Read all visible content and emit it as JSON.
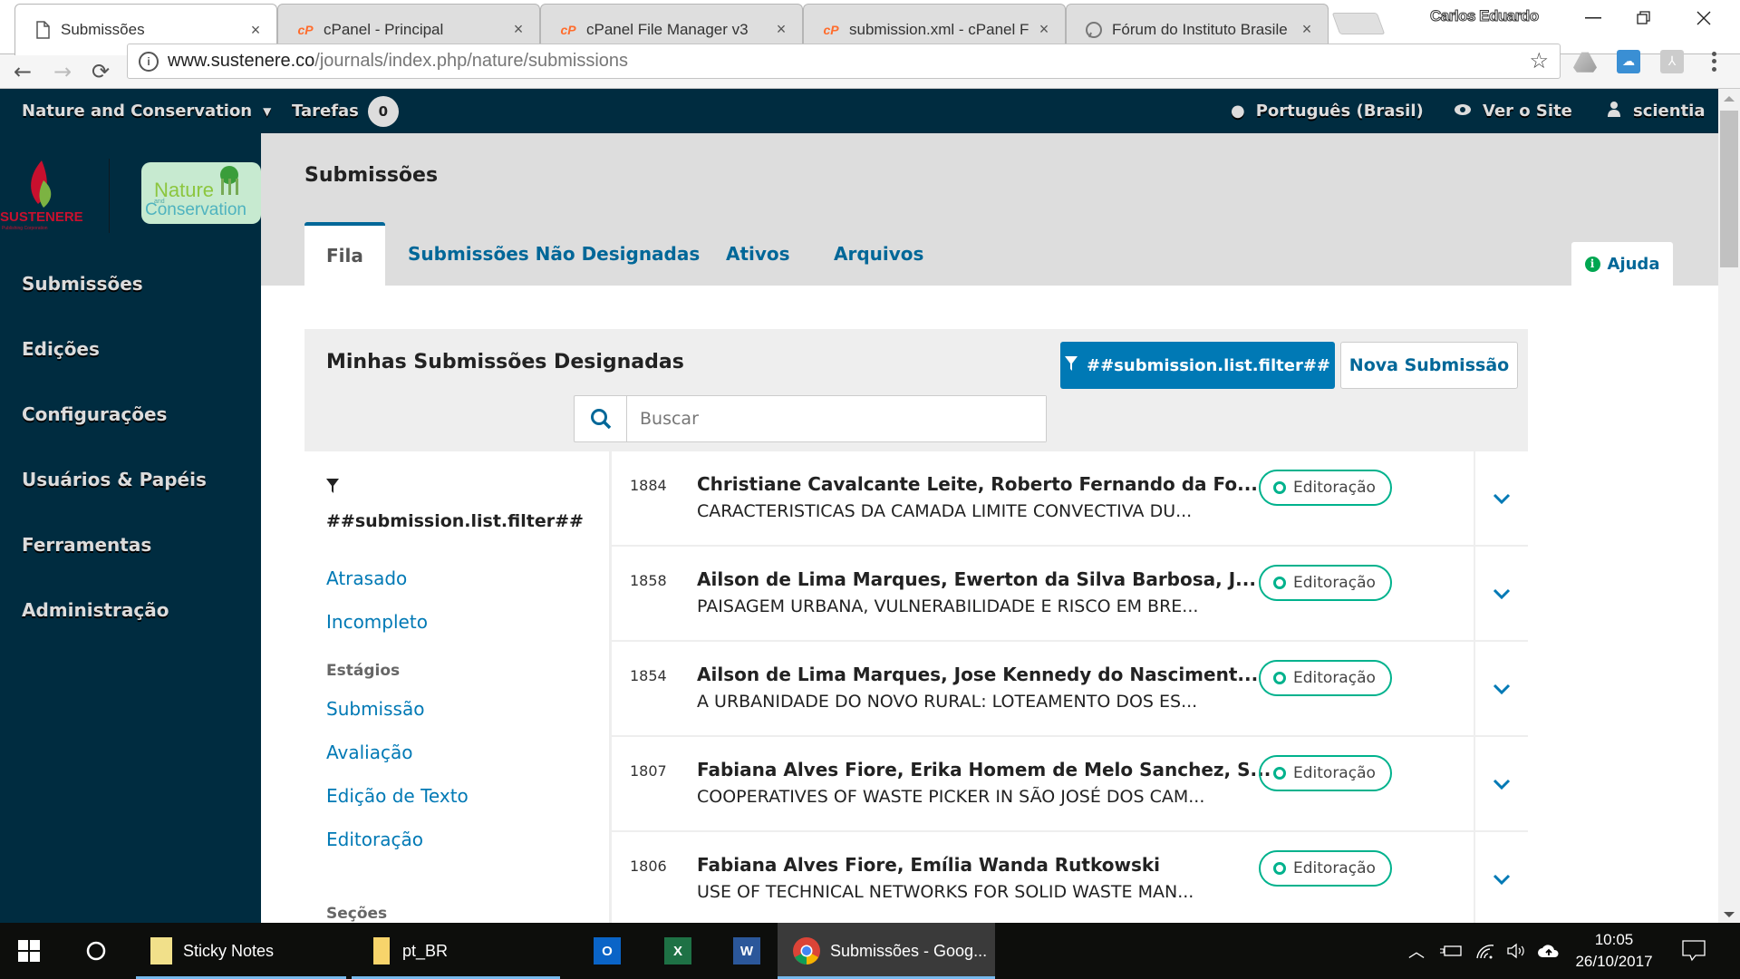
{
  "browser": {
    "tabs": [
      {
        "title": "Submissões",
        "icon": "page-icon",
        "active": true
      },
      {
        "title": "cPanel - Principal",
        "icon": "cpanel-icon",
        "active": false
      },
      {
        "title": "cPanel File Manager v3",
        "icon": "cpanel-icon",
        "active": false
      },
      {
        "title": "submission.xml - cPanel F",
        "icon": "cpanel-icon",
        "active": false
      },
      {
        "title": "Fórum do Instituto Brasile",
        "icon": "forum-icon",
        "active": false
      }
    ],
    "tab_close": "×",
    "profile_name": "Carlos Eduardo",
    "url_host": "www.sustenere.co",
    "url_path": "/journals/index.php/nature/submissions"
  },
  "header": {
    "journal_name": "Nature and Conservation",
    "tasks_label": "Tarefas",
    "tasks_count": "0",
    "language": "Português (Brasil)",
    "view_site": "Ver o Site",
    "user": "scientia"
  },
  "logos": {
    "publisher": "SUSTENERE",
    "publisher_sub": "Publishing Corporation",
    "journal_line1": "Nature",
    "journal_line2": "and",
    "journal_line3": "Conservation"
  },
  "sidebar": {
    "items": [
      {
        "label": "Submissões"
      },
      {
        "label": "Edições"
      },
      {
        "label": "Configurações"
      },
      {
        "label": "Usuários & Papéis"
      },
      {
        "label": "Ferramentas"
      },
      {
        "label": "Administração"
      }
    ]
  },
  "page": {
    "title": "Submissões",
    "tabs": [
      {
        "label": "Fila",
        "active": true
      },
      {
        "label": "Submissões Não Designadas"
      },
      {
        "label": "Ativos"
      },
      {
        "label": "Arquivos"
      }
    ],
    "help_label": "Ajuda"
  },
  "list": {
    "title": "Minhas Submissões Designadas",
    "filter_button": "##submission.list.filter##",
    "new_button": "Nova Submissão",
    "search_placeholder": "Buscar",
    "filters": {
      "heading": "##submission.list.filter##",
      "quick": [
        "Atrasado",
        "Incompleto"
      ],
      "stages_heading": "Estágios",
      "stages": [
        "Submissão",
        "Avaliação",
        "Edição de Texto",
        "Editoração"
      ],
      "sections_heading": "Seções"
    },
    "rows": [
      {
        "id": "1884",
        "authors": "Christiane Cavalcante Leite, Roberto Fernando da Fo...",
        "title": "CARACTERISTICAS DA CAMADA LIMITE CONVECTIVA DU...",
        "stage": "Editoração"
      },
      {
        "id": "1858",
        "authors": "Ailson de Lima Marques, Ewerton da Silva Barbosa, J...",
        "title": "PAISAGEM URBANA, VULNERABILIDADE E RISCO EM BRE...",
        "stage": "Editoração"
      },
      {
        "id": "1854",
        "authors": "Ailson de Lima Marques, Jose Kennedy do Nasciment...",
        "title": "A URBANIDADE DO NOVO RURAL: LOTEAMENTO DOS ES...",
        "stage": "Editoração"
      },
      {
        "id": "1807",
        "authors": "Fabiana Alves Fiore, Erika Homem de Melo Sanchez, S...",
        "title": "COOPERATIVES OF WASTE PICKER IN SÃO JOSÉ DOS CAM...",
        "stage": "Editoração"
      },
      {
        "id": "1806",
        "authors": "Fabiana Alves Fiore, Emília Wanda Rutkowski",
        "title": "USE OF TECHNICAL NETWORKS FOR SOLID WASTE MAN...",
        "stage": "Editoração"
      }
    ]
  },
  "taskbar": {
    "apps": [
      {
        "label": "Sticky Notes"
      },
      {
        "label": "pt_BR"
      },
      {
        "label": ""
      },
      {
        "label": ""
      },
      {
        "label": ""
      },
      {
        "label": "Submissões - Goog..."
      }
    ],
    "time": "10:05",
    "date": "26/10/2017"
  },
  "colors": {
    "header_bg": "#002c40",
    "primary": "#006798",
    "status_green": "#00b28d"
  }
}
